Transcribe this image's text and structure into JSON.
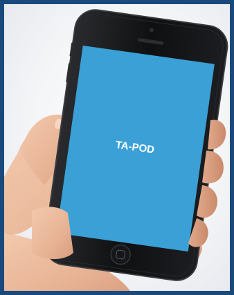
{
  "screen": {
    "label": "TA-POD",
    "background_color": "#3aa0d6"
  },
  "phone": {
    "body_color": "#111214"
  },
  "frame": {
    "border_color": "#1a4a7c"
  }
}
